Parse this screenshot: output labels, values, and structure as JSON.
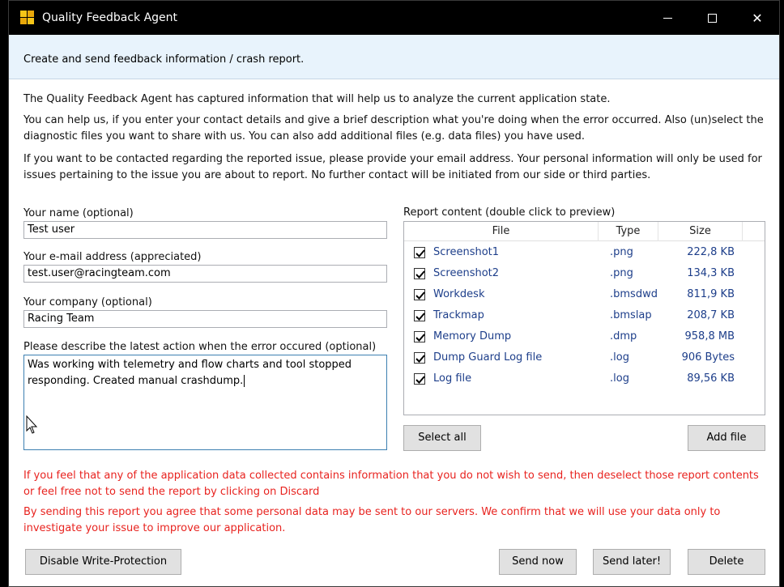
{
  "window": {
    "title": "Quality Feedback Agent",
    "controls": {
      "minimize_icon": "minimize-icon",
      "maximize_icon": "maximize-icon",
      "close_glyph": "✕"
    }
  },
  "header": {
    "text": "Create and send feedback information / crash report."
  },
  "intro": {
    "p1": "The Quality Feedback Agent has captured information that will help us to analyze the current application state.",
    "p2": "You can help us, if you enter your contact details and give a brief description what you're doing when the error occurred. Also (un)select the diagnostic files you want to share with us. You can also add additional files (e.g. data files) you have used.",
    "p3": "If you want to be contacted regarding the reported issue, please provide your email address. Your personal information will only be used for issues pertaining to the issue you are about to report. No further contact will be initiated from our side or third parties."
  },
  "form": {
    "name_label": "Your name (optional)",
    "name_value": "Test user",
    "email_label": "Your e-mail address (appreciated)",
    "email_value": "test.user@racingteam.com",
    "company_label": "Your company (optional)",
    "company_value": "Racing Team",
    "description_label": "Please describe the latest action when the error occured (optional)",
    "description_value": "Was working with telemetry and flow charts and tool stopped responding. Created manual crashdump."
  },
  "report": {
    "label": "Report content (double click to preview)",
    "columns": {
      "file": "File",
      "type": "Type",
      "size": "Size"
    },
    "rows": [
      {
        "name": "Screenshot1",
        "type": ".png",
        "size": "222,8 KB",
        "checked": true
      },
      {
        "name": "Screenshot2",
        "type": ".png",
        "size": "134,3 KB",
        "checked": true
      },
      {
        "name": "Workdesk",
        "type": ".bmsdwd",
        "size": "811,9 KB",
        "checked": true
      },
      {
        "name": "Trackmap",
        "type": ".bmslap",
        "size": "208,7 KB",
        "checked": true
      },
      {
        "name": "Memory Dump",
        "type": ".dmp",
        "size": "958,8 MB",
        "checked": true
      },
      {
        "name": "Dump Guard Log file",
        "type": ".log",
        "size": "906 Bytes",
        "checked": true
      },
      {
        "name": "Log file",
        "type": ".log",
        "size": "89,56 KB",
        "checked": true
      }
    ],
    "select_all": "Select all",
    "add_file": "Add file"
  },
  "warnings": {
    "w1": "If you feel that any of the application data collected contains information that you do not wish to send, then deselect those report contents or feel free not to send the report by clicking on Discard",
    "w2": "By sending this report you agree that some personal data may be sent to our servers. We confirm that we will use your data only to investigate your issue to improve our application."
  },
  "footer": {
    "disable_write_protection": "Disable Write-Protection",
    "send_now": "Send now",
    "send_later": "Send later!",
    "delete": "Delete"
  },
  "colors": {
    "warning": "#e8231f",
    "file_text": "#1d3e8a",
    "header_band": "#e8f3fc"
  }
}
